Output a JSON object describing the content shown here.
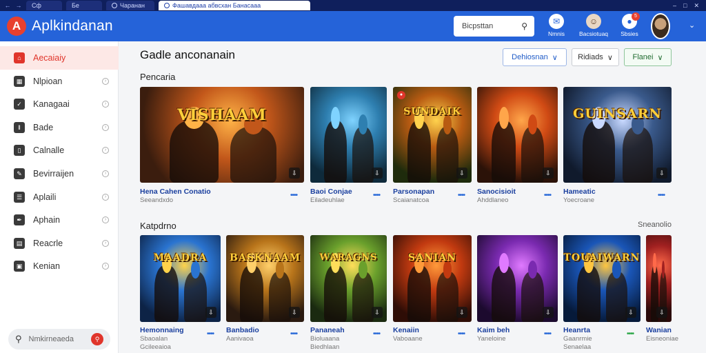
{
  "browser": {
    "tabs": [
      {
        "label": "Сф"
      },
      {
        "label": "Бе"
      },
      {
        "label": "Чаранан"
      },
      {
        "label": "Фашавдааа абвсхан Банасааа"
      }
    ],
    "controls": [
      "–",
      "□",
      "✕"
    ]
  },
  "header": {
    "brand": "Aplkindanan",
    "logo_glyph": "A",
    "search_placeholder": "Bicpsttan",
    "icons": [
      {
        "name": "chat-icon",
        "label": "Nmnis",
        "glyph": "✉"
      },
      {
        "name": "mascot-icon",
        "label": "Bacsiotuaq",
        "glyph": "☺"
      },
      {
        "name": "notification-icon",
        "label": "Sbsies",
        "glyph": "●",
        "badge": "5"
      }
    ],
    "accent": "#2563d9"
  },
  "sidebar": {
    "items": [
      {
        "label": "Aecaiaiy",
        "icon": "home-icon",
        "glyph": "⌂",
        "active": true
      },
      {
        "label": "Nlpioan",
        "icon": "grid-icon",
        "glyph": "▦",
        "active": false
      },
      {
        "label": "Kanagaai",
        "icon": "checkbox-icon",
        "glyph": "✓",
        "active": false
      },
      {
        "label": "Bade",
        "icon": "pause-icon",
        "glyph": "‖",
        "active": false
      },
      {
        "label": "Calnalle",
        "icon": "phone-icon",
        "glyph": "▯",
        "active": false
      },
      {
        "label": "Bevirraijen",
        "icon": "edit-icon",
        "glyph": "✎",
        "active": false
      },
      {
        "label": "Aplaili",
        "icon": "document-icon",
        "glyph": "☰",
        "active": false
      },
      {
        "label": "Aphain",
        "icon": "pen-icon",
        "glyph": "✒",
        "active": false
      },
      {
        "label": "Reacrle",
        "icon": "book-icon",
        "glyph": "▤",
        "active": false
      },
      {
        "label": "Kenian",
        "icon": "calendar-icon",
        "glyph": "▣",
        "active": false
      }
    ],
    "search_text": "Nmkirneaeda",
    "active_color": "#e0352b"
  },
  "main": {
    "title": "Gadle anconanain",
    "filters": [
      {
        "label": "Dehiosnan",
        "caret": "∨"
      },
      {
        "label": "Ridiads",
        "caret": "∨"
      },
      {
        "label": "Flanei",
        "caret": "∨"
      }
    ],
    "sections": [
      {
        "title": "Pencaria",
        "cards": [
          {
            "title": "Hena Cahen Conatio",
            "sub": "Seeandxdo",
            "art": "VISHAAM"
          },
          {
            "title": "Baoi Conjae",
            "sub": "Eiladeuhlae",
            "art": ""
          },
          {
            "title": "Parsonapan",
            "sub": "Scaianatcoa",
            "art": "SUNDAIK"
          },
          {
            "title": "Sanocisioit",
            "sub": "Ahddlaneo",
            "art": ""
          },
          {
            "title": "Hameatic",
            "sub": "Yoecroane",
            "art": "GUINSARN"
          }
        ]
      },
      {
        "title": "Katpdrno",
        "see_all": "Sneanolio",
        "cards": [
          {
            "title": "Hemonnaing",
            "sub": "Sbaoalan",
            "sub2": "Gcileeaioa",
            "art": "MAADRA"
          },
          {
            "title": "Banbadio",
            "sub": "Aanivaoa",
            "sub2": "",
            "art": "BASKNAAM"
          },
          {
            "title": "Pananeah",
            "sub": "Bioluaana",
            "sub2": "Biedhlaan",
            "art": "WARAGNS"
          },
          {
            "title": "Kenaiin",
            "sub": "Vaboaane",
            "sub2": "",
            "art": "SANIAN"
          },
          {
            "title": "Kaim beh",
            "sub": "Yaneloine",
            "sub2": "",
            "art": ""
          },
          {
            "title": "Heanrta",
            "sub": "Gaanrmie",
            "sub2": "Senaelaa",
            "art": "TOUAIWARN"
          },
          {
            "title": "Wanian",
            "sub": "Eisneoniae",
            "sub2": "",
            "art": ""
          }
        ]
      }
    ]
  }
}
